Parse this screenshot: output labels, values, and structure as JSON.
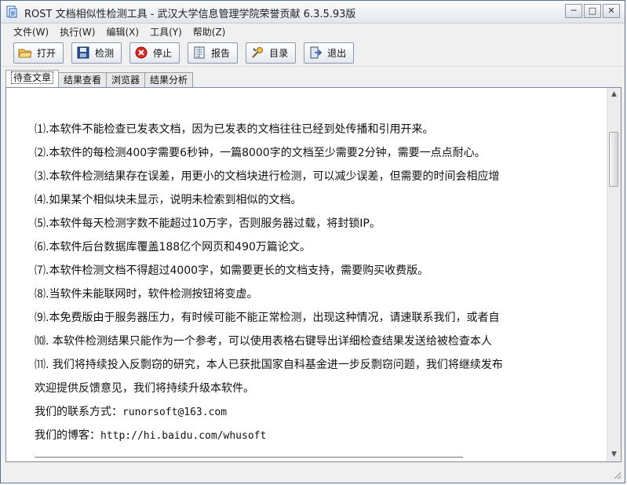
{
  "window": {
    "title": "ROST 文档相似性检测工具 - 武汉大学信息管理学院荣誉贡献 6.3.5.93版",
    "controls": [
      "─",
      "□",
      "✕"
    ]
  },
  "menu": [
    "文件(W)",
    "执行(W)",
    "编辑(X)",
    "工具(Y)",
    "帮助(Z)"
  ],
  "toolbar": {
    "open": "打开",
    "detect": "检测",
    "stop": "停止",
    "report": "报告",
    "toc": "目录",
    "exit": "退出"
  },
  "tabs": [
    "待查文章",
    "结果查看",
    "浏览器",
    "结果分析"
  ],
  "content": {
    "lines": [
      "⑴.本软件不能检查已发表文档，因为已发表的文档往往已经到处传播和引用开来。",
      "⑵.本软件的每检测400字需要6秒钟，一篇8000字的文档至少需要2分钟，需要一点点耐心。",
      "⑶.本软件检测结果存在误差，用更小的文档块进行检测，可以减少误差，但需要的时间会相应增",
      "⑷.如果某个相似块未显示，说明未检索到相似的文档。",
      "⑸.本软件每天检测字数不能超过10万字，否则服务器过载，将封锁IP。",
      "⑹.本软件后台数据库覆盖188亿个网页和490万篇论文。",
      "⑺.本软件检测文档不得超过4000字，如需要更长的文档支持，需要购买收费版。",
      "⑻.当软件未能联网时，软件检测按钮将变虚。",
      "⑼.本免费版由于服务器压力，有时候可能不能正常检测，出现这种情况，请速联系我们，或者自",
      "⑽. 本软件检测结果只能作为一个参考，可以使用表格右键导出详细检查结果发送给被检查本人",
      "⑾. 我们将持续投入反剽窃的研究，本人已获批国家自科基金进一步反剽窃问题，我们将继续发布",
      "欢迎提供反馈意见，我们将持续升级本软件。"
    ],
    "contact_label": "我们的联系方式：",
    "contact_value": "runorsoft@163.com",
    "blog_label": "我们的博客：",
    "blog_value": "http://hi.baidu.com/whusoft"
  }
}
